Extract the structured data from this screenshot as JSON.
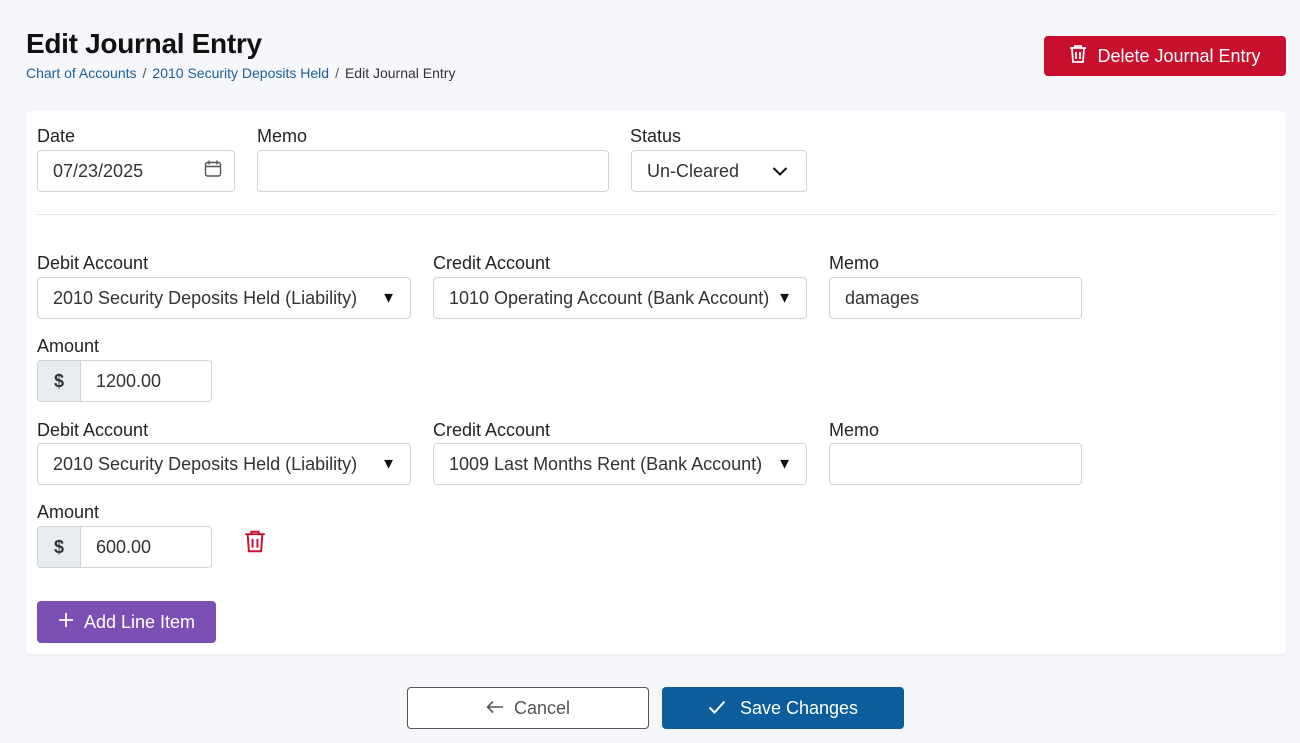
{
  "header": {
    "title": "Edit Journal Entry",
    "breadcrumb": [
      "Chart of Accounts",
      "2010 Security Deposits Held",
      "Edit Journal Entry"
    ],
    "breadcrumb_sep": "/",
    "delete_label": "Delete Journal Entry"
  },
  "entry": {
    "date_label": "Date",
    "date_value": "07/23/2025",
    "memo_label": "Memo",
    "memo_value": "",
    "status_label": "Status",
    "status_value": "Un-Cleared"
  },
  "line_items": [
    {
      "debit_label": "Debit Account",
      "debit_value": "2010 Security Deposits Held (Liability)",
      "credit_label": "Credit Account",
      "credit_value": "1010 Operating Account (Bank Account)",
      "memo_label": "Memo",
      "memo_value": "damages",
      "amount_label": "Amount",
      "amount_prefix": "$",
      "amount_value": "1200.00"
    },
    {
      "debit_label": "Debit Account",
      "debit_value": "2010 Security Deposits Held (Liability)",
      "credit_label": "Credit Account",
      "credit_value": "1009 Last Months Rent (Bank Account)",
      "memo_label": "Memo",
      "memo_value": "",
      "amount_label": "Amount",
      "amount_prefix": "$",
      "amount_value": "600.00"
    }
  ],
  "actions": {
    "add_line_label": "Add Line Item",
    "cancel_label": "Cancel",
    "save_label": "Save Changes"
  },
  "icons": {
    "delete": "trash-icon",
    "date": "calendar-icon",
    "status": "chevron-down-icon",
    "select": "caret-down-icon",
    "add": "plus-icon",
    "cancel": "arrow-left-icon",
    "save": "check-icon"
  },
  "colors": {
    "danger": "#c8102e",
    "primary": "#0b5d9b",
    "purple": "#7b4fb3",
    "link": "#1d5f95"
  }
}
